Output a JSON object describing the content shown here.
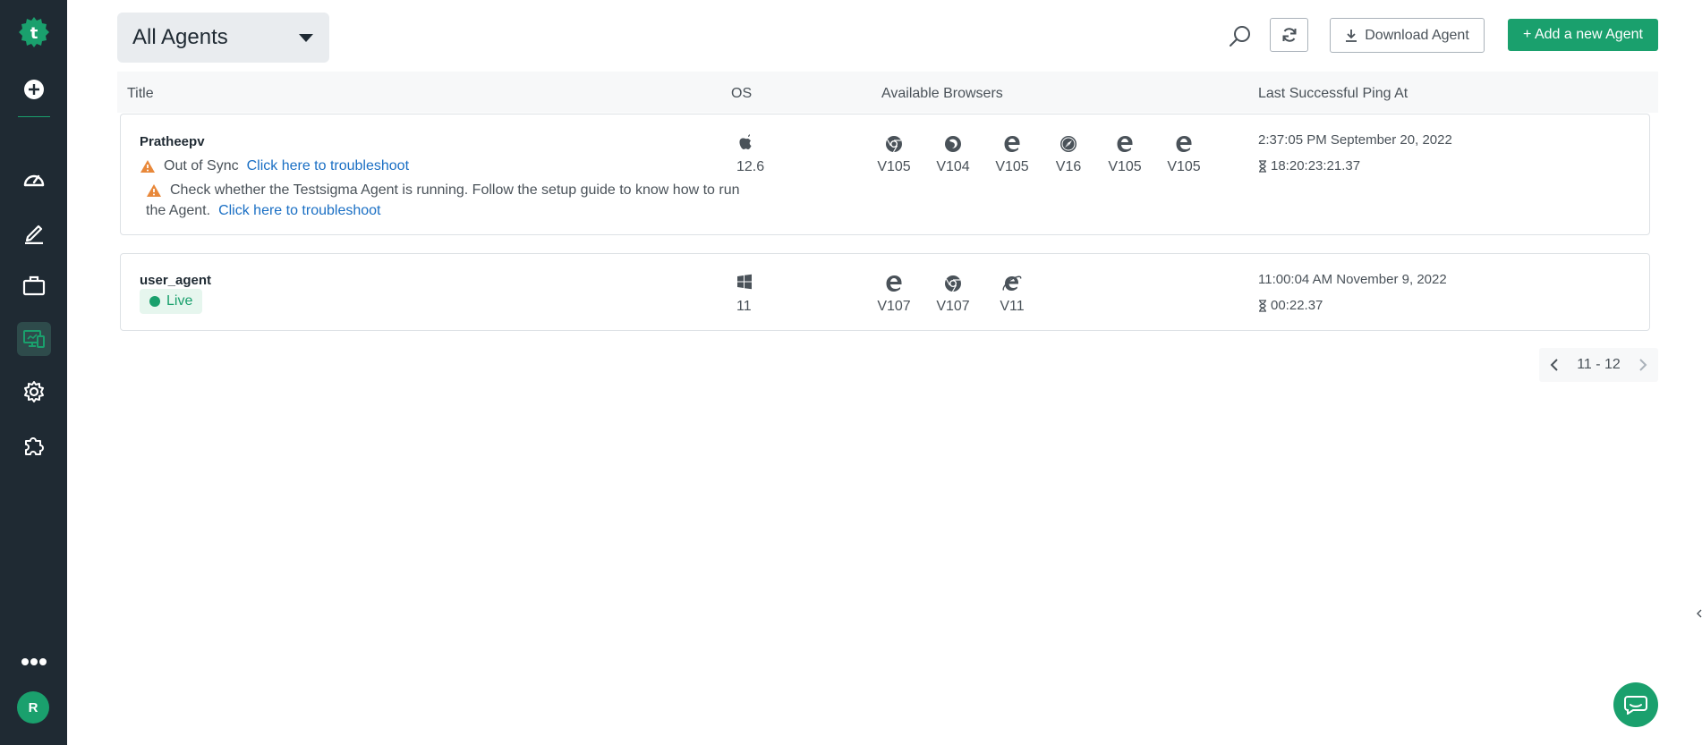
{
  "sidebar": {
    "items": [
      {
        "name": "logo",
        "icon": "testsigma-logo"
      },
      {
        "name": "create",
        "icon": "plus-circle-icon"
      },
      {
        "name": "dashboard",
        "icon": "speedometer-icon"
      },
      {
        "name": "test-development",
        "icon": "pencil-icon"
      },
      {
        "name": "test-plans",
        "icon": "briefcase-icon"
      },
      {
        "name": "agents",
        "icon": "devices-icon",
        "active": true
      },
      {
        "name": "settings",
        "icon": "gear-icon"
      },
      {
        "name": "addons",
        "icon": "puzzle-icon"
      },
      {
        "name": "more",
        "icon": "ellipsis-icon"
      }
    ],
    "avatar_initial": "R",
    "logo_letter": "t"
  },
  "header": {
    "filter_label": "All Agents",
    "download_label": "Download Agent",
    "add_label": "+ Add a new Agent"
  },
  "table": {
    "columns": {
      "title": "Title",
      "os": "OS",
      "browsers": "Available Browsers",
      "ping": "Last Successful Ping At"
    },
    "rows": [
      {
        "name": "Pratheepv",
        "status": "Out of Sync",
        "troubleshoot_link": "Click here to troubleshoot",
        "warning_text_1": "Check whether the Testsigma Agent is running. Follow the setup guide to know how to run",
        "warning_text_2": "the Agent.",
        "warning_link": "Click here to troubleshoot",
        "os_icon": "apple-icon",
        "os_version": "12.6",
        "browsers": [
          {
            "icon": "chrome-icon",
            "version": "V105"
          },
          {
            "icon": "firefox-icon",
            "version": "V104"
          },
          {
            "icon": "edge-icon",
            "version": "V105"
          },
          {
            "icon": "safari-icon",
            "version": "V16"
          },
          {
            "icon": "edge-icon",
            "version": "V105"
          },
          {
            "icon": "edge-icon",
            "version": "V105"
          }
        ],
        "ping_date": "2:37:05 PM September 20, 2022",
        "ping_duration": "18:20:23:21.37"
      },
      {
        "name": "user_agent",
        "status": "Live",
        "os_icon": "windows-icon",
        "os_version": "11",
        "browsers": [
          {
            "icon": "edge-icon",
            "version": "V107"
          },
          {
            "icon": "chrome-icon",
            "version": "V107"
          },
          {
            "icon": "internet-explorer-icon",
            "version": "V11"
          }
        ],
        "ping_date": "11:00:04 AM November 9, 2022",
        "ping_duration": "00:22.37"
      }
    ]
  },
  "pagination": {
    "range": "11 - 12"
  },
  "colors": {
    "sidebar": "#1f2a33",
    "accent": "#1aa06d",
    "link": "#1a6fc4",
    "warning": "#e8883a"
  }
}
